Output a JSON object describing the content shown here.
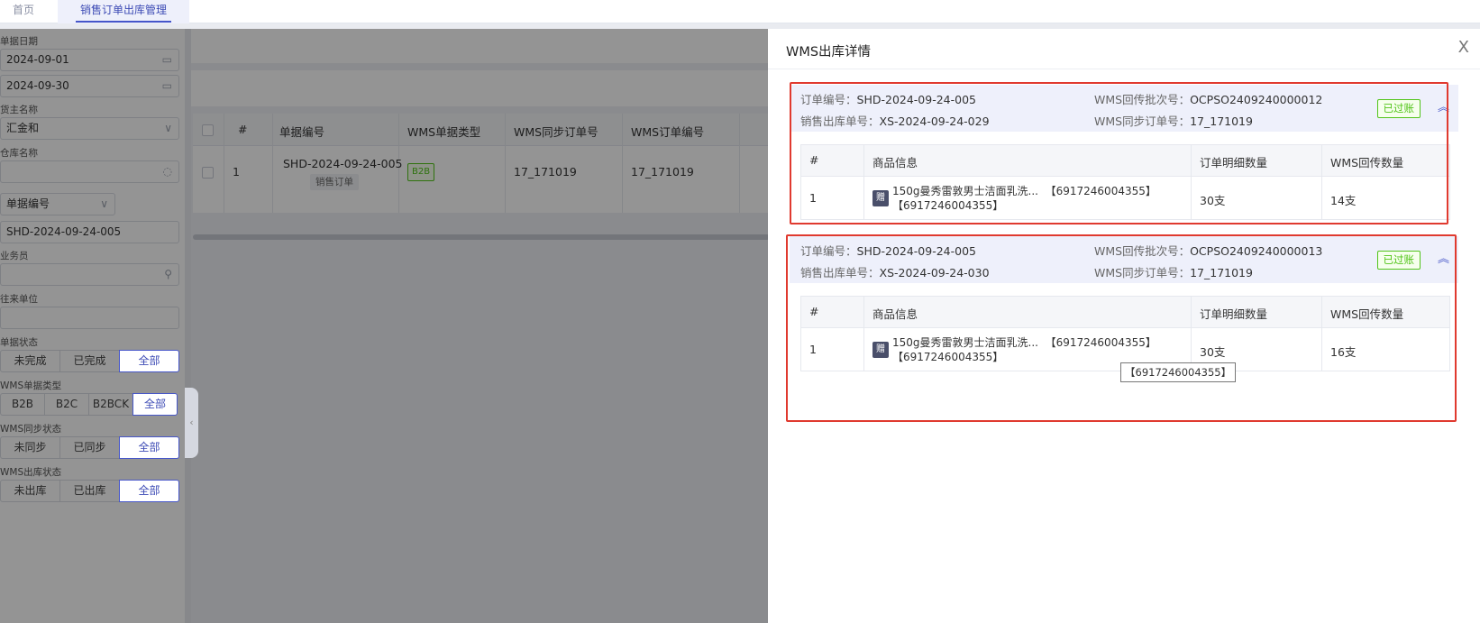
{
  "tabs": [
    "首页",
    "销售订单出库管理"
  ],
  "filters": {
    "doc_date_label": "单据日期",
    "date_start": "2024-09-01",
    "date_end": "2024-09-30",
    "owner_label": "货主名称",
    "owner_value": "汇金和",
    "warehouse_label": "仓库名称",
    "warehouse_value": "",
    "docno_type": "单据编号",
    "docno_value": "SHD-2024-09-24-005",
    "salesman_label": "业务员",
    "partner_label": "往来单位",
    "status_label": "单据状态",
    "status_options": [
      "未完成",
      "已完成",
      "全部"
    ],
    "wms_type_label": "WMS单据类型",
    "wms_type_options": [
      "B2B",
      "B2C",
      "B2BCK",
      "全部"
    ],
    "sync_label": "WMS同步状态",
    "sync_options": [
      "未同步",
      "已同步",
      "全部"
    ],
    "out_label": "WMS出库状态",
    "out_options": [
      "未出库",
      "已出库",
      "全部"
    ]
  },
  "grid": {
    "headers": [
      "#",
      "单据编号",
      "WMS单据类型",
      "WMS同步订单号",
      "WMS订单编号"
    ],
    "row": {
      "index": "1",
      "docno": "SHD-2024-09-24-005",
      "doc_tag": "销售订单",
      "wms_type": "B2B",
      "sync_no": "17_171019",
      "wms_no": "17_171019"
    }
  },
  "drawer": {
    "title": "WMS出库详情",
    "close": "X",
    "blocks": [
      {
        "order_no_label": "订单编号：",
        "order_no": "SHD-2024-09-24-005",
        "batch_label": "WMS回传批次号：",
        "batch": "OCPSO2409240000012",
        "out_no_label": "销售出库单号：",
        "out_no": "XS-2024-09-24-029",
        "sync_label": "WMS同步订单号：",
        "sync": "17_171019",
        "status": "已过账",
        "table_headers": [
          "#",
          "商品信息",
          "订单明细数量",
          "WMS回传数量"
        ],
        "row": {
          "index": "1",
          "gift": "赠",
          "name": "150g曼秀雷敦男士洁面乳洗...",
          "code1": "【6917246004355】",
          "code2": "【6917246004355】",
          "order_qty": "30支",
          "wms_qty": "14支"
        }
      },
      {
        "order_no_label": "订单编号：",
        "order_no": "SHD-2024-09-24-005",
        "batch_label": "WMS回传批次号：",
        "batch": "OCPSO2409240000013",
        "out_no_label": "销售出库单号：",
        "out_no": "XS-2024-09-24-030",
        "sync_label": "WMS同步订单号：",
        "sync": "17_171019",
        "status": "已过账",
        "table_headers": [
          "#",
          "商品信息",
          "订单明细数量",
          "WMS回传数量"
        ],
        "row": {
          "index": "1",
          "gift": "赠",
          "name": "150g曼秀雷敦男士洁面乳洗...",
          "code1": "【6917246004355】",
          "code2": "【6917246004355】",
          "order_qty": "30支",
          "wms_qty": "16支"
        }
      }
    ],
    "tooltip": "【6917246004355】"
  },
  "colors": {
    "accent": "#4656c9",
    "success": "#52c41a",
    "highlight": "#e03a2f"
  }
}
